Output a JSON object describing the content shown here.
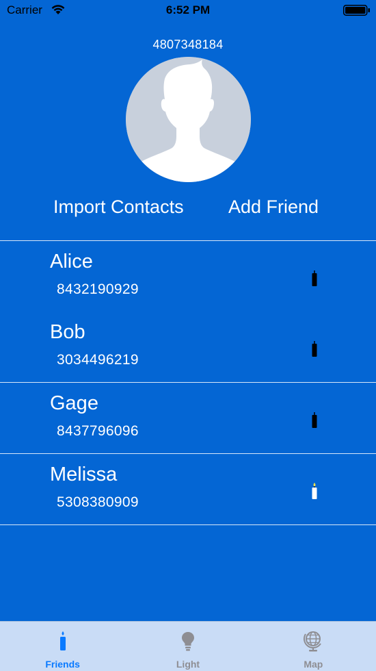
{
  "status_bar": {
    "carrier": "Carrier",
    "time": "6:52 PM"
  },
  "profile": {
    "phone": "4807348184",
    "avatar_icon": "person-silhouette-icon"
  },
  "actions": {
    "import_label": "Import Contacts",
    "add_label": "Add Friend"
  },
  "friends": [
    {
      "name": "Alice",
      "phone": "8432190929",
      "lit": false
    },
    {
      "name": "Bob",
      "phone": "3034496219",
      "lit": false
    },
    {
      "name": "Gage",
      "phone": "8437796096",
      "lit": false
    },
    {
      "name": "Melissa",
      "phone": "5308380909",
      "lit": true
    }
  ],
  "tabs": [
    {
      "label": "Friends",
      "icon": "candle-icon",
      "active": true
    },
    {
      "label": "Light",
      "icon": "lightbulb-icon",
      "active": false
    },
    {
      "label": "Map",
      "icon": "globe-icon",
      "active": false
    }
  ],
  "colors": {
    "background": "#0466d4",
    "tab_bar": "#c9dcf6",
    "tab_active": "#0a7aff",
    "tab_inactive": "#8e8e93",
    "flame": "#f2e24a"
  }
}
